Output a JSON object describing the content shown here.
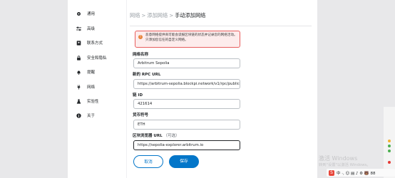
{
  "sidebar": {
    "items": [
      {
        "label": "通用",
        "icon": "gear-icon"
      },
      {
        "label": "高级",
        "icon": "sliders-icon"
      },
      {
        "label": "联系方式",
        "icon": "contact-book-icon"
      },
      {
        "label": "安全和隐私",
        "icon": "lock-icon"
      },
      {
        "label": "提醒",
        "icon": "bell-icon"
      },
      {
        "label": "网络",
        "icon": "plug-icon"
      },
      {
        "label": "实验性",
        "icon": "flask-icon"
      },
      {
        "label": "关于",
        "icon": "info-icon"
      }
    ]
  },
  "breadcrumb": {
    "part1": "网络",
    "sep1": ">",
    "part2": "添加网络",
    "sep2": ">",
    "current": "手动添加网络"
  },
  "warning": {
    "text": "恶意网络提供商可能会谎报区块链的状态并记录您的网络活动。只添加您信任的自定义网络。"
  },
  "form": {
    "network_name": {
      "label": "网络名称",
      "value": "Arbitrum Sepolia"
    },
    "rpc_url": {
      "label": "新的 RPC URL",
      "value": "https://arbitrum-sepolia.blockpi.network/v1/rpc/public"
    },
    "chain_id": {
      "label": "链 ID",
      "value": "421614"
    },
    "currency_symbol": {
      "label": "货币符号",
      "value": "ETH"
    },
    "explorer_url": {
      "label": "区块浏览器 URL",
      "optional": "（可选）",
      "value": "https://sepolia-explorer.arbitrum.io"
    }
  },
  "buttons": {
    "cancel": "取消",
    "save": "保存"
  },
  "os": {
    "watermark_title": "激活 Windows",
    "watermark_sub": "转到\"设置\"以激活 Windows。",
    "ime_text": "中 ·, ☺ ▤ ♪ ⚙ 🐻 88"
  },
  "colors": {
    "accent": "#0376c9",
    "warning_border": "#e85d5d",
    "warning_bg": "#fdecec"
  }
}
